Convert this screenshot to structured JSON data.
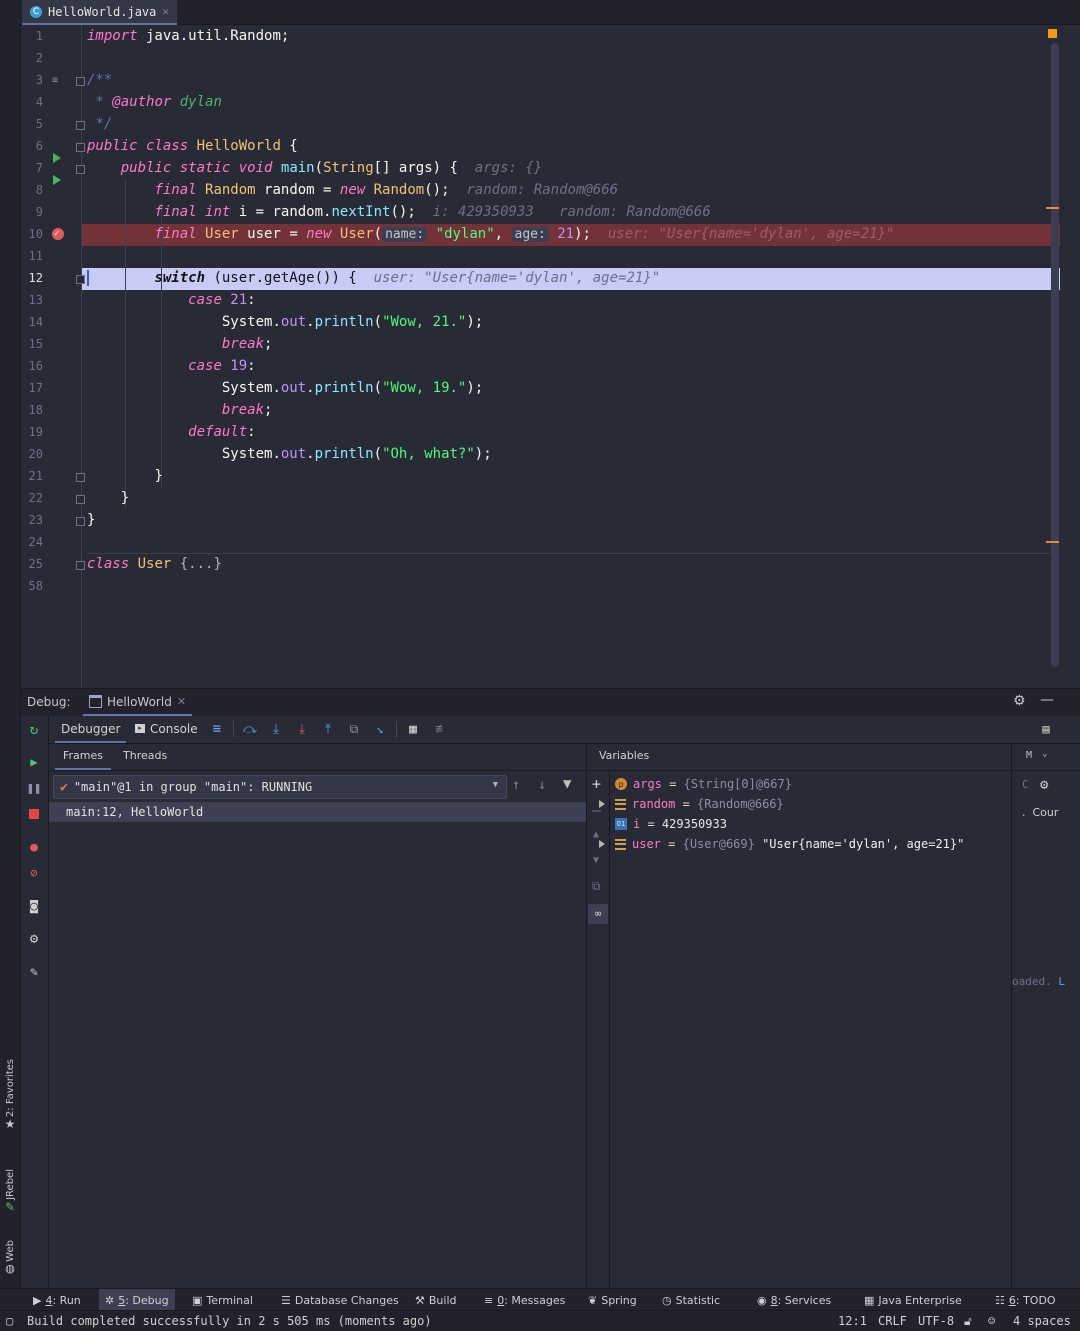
{
  "editor_tab": {
    "filename": "HelloWorld.java",
    "icon": "java-class-icon"
  },
  "code": {
    "line_numbers": [
      "1",
      "2",
      "3",
      "4",
      "5",
      "6",
      "7",
      "8",
      "9",
      "10",
      "11",
      "12",
      "13",
      "14",
      "15",
      "16",
      "17",
      "18",
      "19",
      "20",
      "21",
      "22",
      "23",
      "24",
      "25",
      "58"
    ],
    "current_line": "12",
    "l1": {
      "kw": "import",
      "rest": " java.util.Random;"
    },
    "l3": {
      "cmt": "/**"
    },
    "l4": {
      "star": " * ",
      "tag": "@author",
      "name": " dylan"
    },
    "l5": {
      "cmt": " */"
    },
    "l6": {
      "kw1": "public",
      "kw2": " class",
      "cls": " HelloWorld",
      "rest": " {"
    },
    "l7": {
      "kw1": "public",
      "kw2": " static",
      "kw3": " void",
      "fn": " main",
      "p1": "(",
      "cls": "String",
      "p2": "[] args) {",
      "hint": "  args: {}"
    },
    "l8": {
      "kw": "final",
      "cls": " Random",
      "mid": " random = ",
      "kw2": "new",
      "cls2": " Random",
      "end": "();",
      "hint": "  random: Random@666"
    },
    "l9": {
      "kw": "final",
      "kw2": " int",
      "mid": " i = random.",
      "mth": "nextInt",
      "end": "();",
      "hint": "  i: 429350933   random: Random@666"
    },
    "l10": {
      "kw": "final",
      "cls": " User",
      "mid": " user = ",
      "kw2": "new",
      "cls2": " User",
      "p1": "(",
      "inlay1": "name:",
      "str": " \"dylan\"",
      "comma": ", ",
      "inlay2": "age:",
      "num": " 21",
      "end": ");",
      "hint": "  user: \"User{name='dylan', age=21}\""
    },
    "l12": {
      "kw": "switch",
      "rest": " (user.getAge()) {",
      "hint": "  user: \"User{name='dylan', age=21}\""
    },
    "l13": {
      "kw": "case",
      "num": " 21",
      "end": ":"
    },
    "l14": {
      "cls": "System",
      "dot": ".",
      "field": "out",
      "dot2": ".",
      "mth": "println",
      "p1": "(",
      "str": "\"Wow, 21.\"",
      "end": ");"
    },
    "l15": {
      "kw": "break",
      "end": ";"
    },
    "l16": {
      "kw": "case",
      "num": " 19",
      "end": ":"
    },
    "l17": {
      "cls": "System",
      "dot": ".",
      "field": "out",
      "dot2": ".",
      "mth": "println",
      "p1": "(",
      "str": "\"Wow, 19.\"",
      "end": ");"
    },
    "l18": {
      "kw": "break",
      "end": ";"
    },
    "l19": {
      "kw": "default",
      "end": ":"
    },
    "l20": {
      "cls": "System",
      "dot": ".",
      "field": "out",
      "dot2": ".",
      "mth": "println",
      "p1": "(",
      "str": "\"Oh, what?\"",
      "end": ");"
    },
    "l21": {
      "text": "}"
    },
    "l22": {
      "text": "}"
    },
    "l23": {
      "text": "}"
    },
    "l25": {
      "kw": "class",
      "cls": " User",
      "fold": " {...}"
    }
  },
  "debug": {
    "label": "Debug:",
    "session_tab": "HelloWorld",
    "tabs": {
      "debugger": "Debugger",
      "console": "Console"
    },
    "frames_tab": "Frames",
    "threads_tab": "Threads",
    "variables_title": "Variables",
    "thread_value": "\"main\"@1 in group \"main\": RUNNING",
    "frame": "main:12, HelloWorld",
    "watches_label": "M",
    "watches_text": "Cour",
    "watches_loaded": "oaded."
  },
  "variables": [
    {
      "name": "args",
      "eq": " = ",
      "value": "{String[0]@667}",
      "icon": "parameter-icon",
      "expandable": false
    },
    {
      "name": "random",
      "eq": " = ",
      "value": "{Random@666}",
      "icon": "field-icon",
      "expandable": true
    },
    {
      "name": "i",
      "eq": " = ",
      "value": "429350933",
      "icon": "int-icon",
      "expandable": false
    },
    {
      "name": "user",
      "eq": " = ",
      "value": "{User@669}",
      "extra": " \"User{name='dylan', age=21}\"",
      "icon": "field-icon",
      "expandable": true
    }
  ],
  "left_strip": {
    "favorites": "2: Favorites",
    "jrebel": "JRebel",
    "web": "Web"
  },
  "tool_windows": [
    {
      "key": "4",
      "label": ": Run"
    },
    {
      "key": "5",
      "label": ": Debug"
    },
    {
      "label": "Terminal"
    },
    {
      "label": "Database Changes"
    },
    {
      "label": "Build"
    },
    {
      "key": "0",
      "label": ": Messages"
    },
    {
      "label": "Spring"
    },
    {
      "label": "Statistic"
    },
    {
      "key": "8",
      "label": ": Services"
    },
    {
      "label": "Java Enterprise"
    },
    {
      "key": "6",
      "label": ": TODO"
    }
  ],
  "status": {
    "message": "Build completed successfully in 2 s 505 ms (moments ago)",
    "position": "12:1",
    "line_sep": "CRLF",
    "encoding": "UTF-8",
    "indent": "4 spaces"
  },
  "colors": {
    "accent": "#6272a4",
    "breakpoint_line": "#733238",
    "exec_line": "#c7cbf6",
    "run_green": "#43b360"
  }
}
